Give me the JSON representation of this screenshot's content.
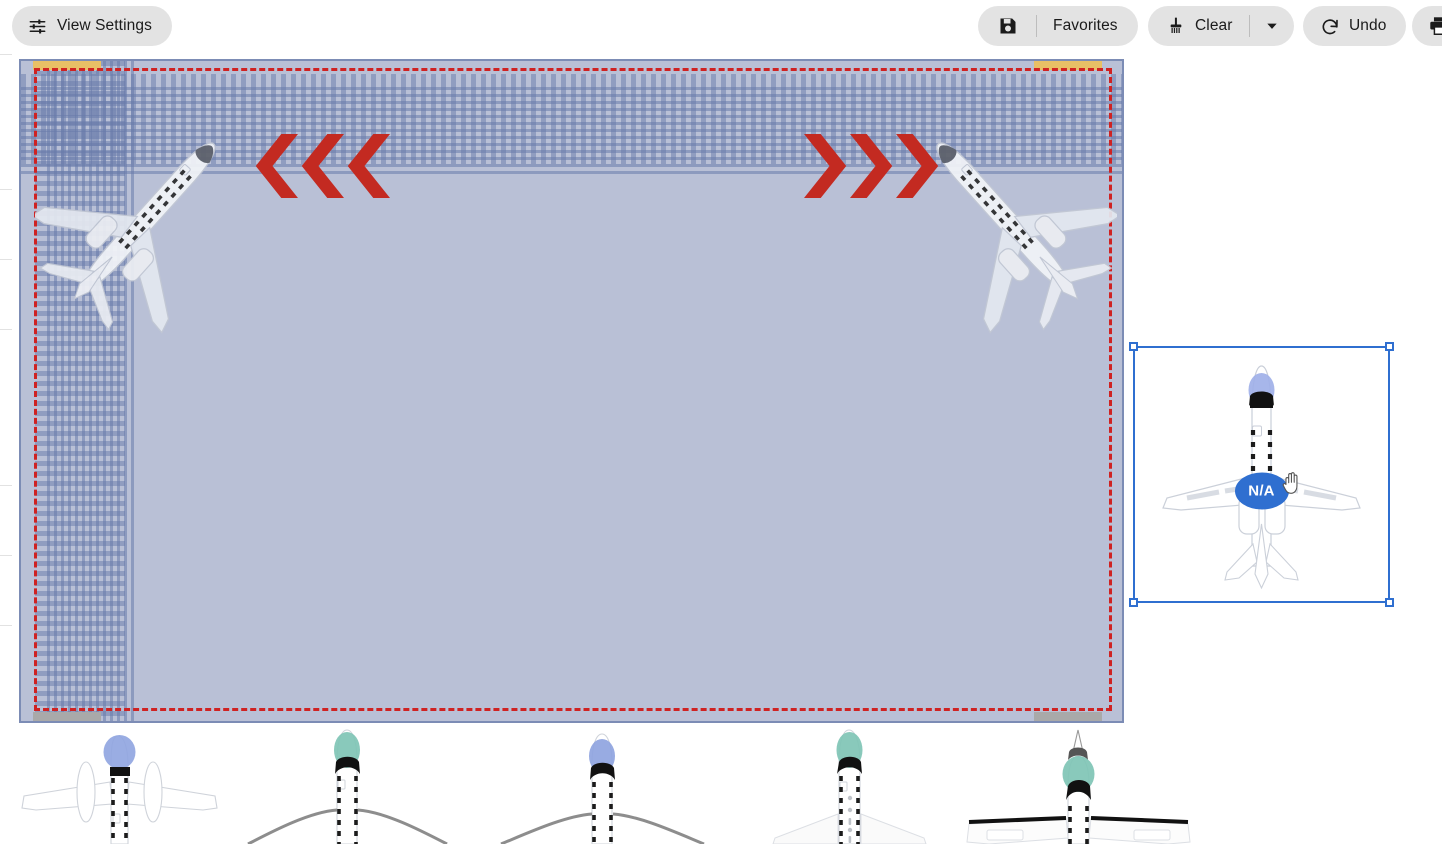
{
  "toolbar": {
    "view_settings": {
      "label": "View Settings",
      "icon": "sliders-icon"
    },
    "favorites": {
      "label": "Favorites",
      "icon": "save-icon"
    },
    "clear": {
      "label": "Clear",
      "icon": "broom-icon",
      "caret_icon": "chevron-down-icon"
    },
    "undo": {
      "label": "Undo",
      "icon": "undo-arrow-icon"
    },
    "print": {
      "icon": "printer-icon"
    }
  },
  "canvas": {
    "background_color": "#b9c0d6",
    "border_color": "#7c8cb5",
    "restricted_zone_color": "#cf2222",
    "grid_color": "#687aaa",
    "marker_bands": [
      {
        "name": "top-left-band",
        "color": "#e8c066"
      },
      {
        "name": "top-right-band",
        "color": "#e8c066"
      },
      {
        "name": "bottom-left-band",
        "color": "#a9a9a9"
      },
      {
        "name": "bottom-right-band",
        "color": "#a9a9a9"
      }
    ],
    "flow_arrows": [
      {
        "name": "flow-arrow-left",
        "direction": "left",
        "count": 3,
        "color": "#c32a21"
      },
      {
        "name": "flow-arrow-right",
        "direction": "right",
        "count": 3,
        "color": "#c32a21"
      }
    ],
    "placed_aircraft": [
      {
        "name": "aircraft-top-left",
        "rotation_deg": 42
      },
      {
        "name": "aircraft-top-right",
        "rotation_deg": -42
      }
    ]
  },
  "selection": {
    "badge_label": "N/A",
    "badge_color": "#2f6fd0",
    "outline_color": "#2f6fd0",
    "cursor": "grab-hand-cursor",
    "aircraft_name": "selected-aircraft-shape"
  },
  "palette": {
    "items": [
      {
        "name": "palette-aircraft-turboprop-twin",
        "nose_color": "#8fa4e0"
      },
      {
        "name": "palette-aircraft-regional-jet",
        "nose_color": "#7fc4b5"
      },
      {
        "name": "palette-aircraft-narrowbody-jet",
        "nose_color": "#8fa4e0"
      },
      {
        "name": "palette-aircraft-widebody-jet",
        "nose_color": "#7fc4b5"
      },
      {
        "name": "palette-aircraft-business-jet",
        "nose_color": "#7fc4b5"
      }
    ]
  }
}
